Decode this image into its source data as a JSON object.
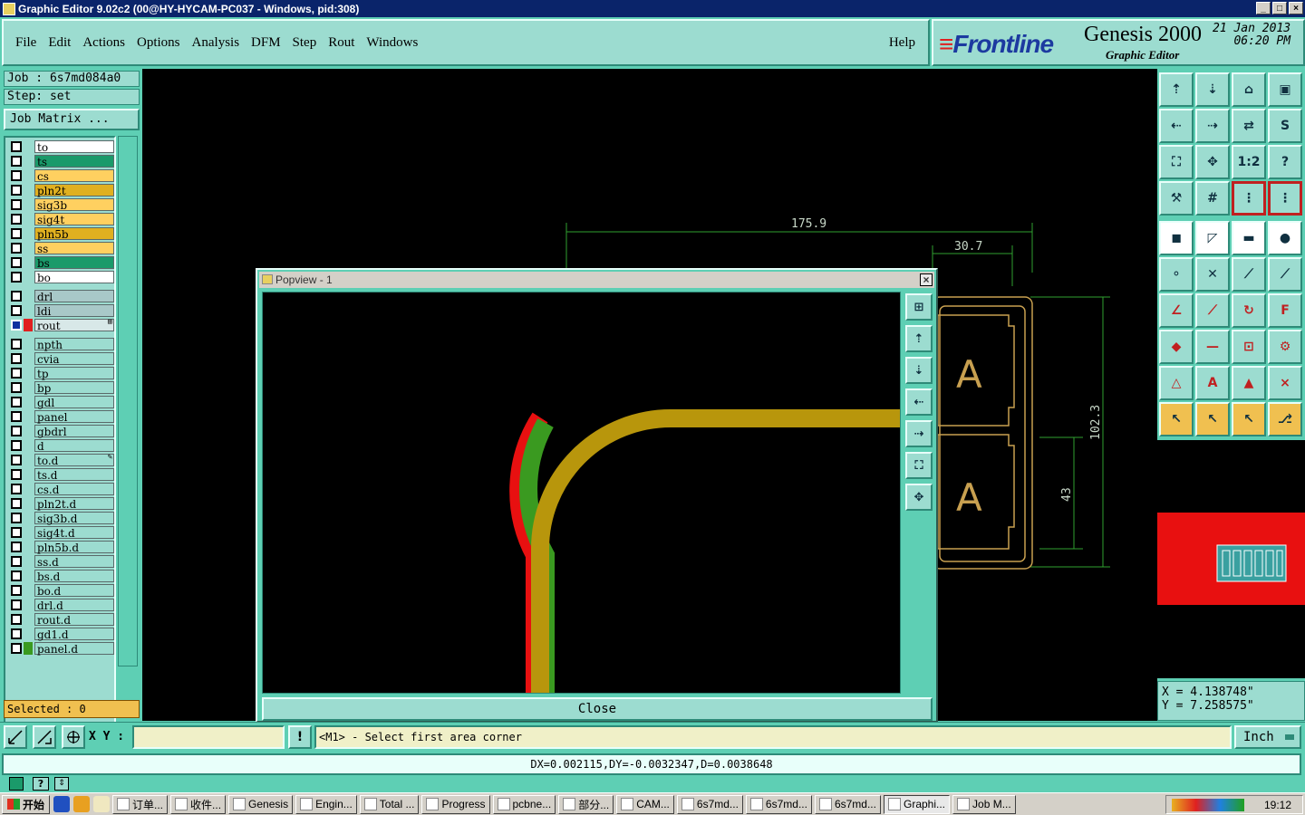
{
  "window": {
    "title": "Graphic Editor 9.02c2 (00@HY-HYCAM-PC037 - Windows, pid:308)",
    "btn_min": "_",
    "btn_max": "□",
    "btn_close": "×"
  },
  "menu": [
    {
      "label": "File"
    },
    {
      "label": "Edit"
    },
    {
      "label": "Actions"
    },
    {
      "label": "Options"
    },
    {
      "label": "Analysis"
    },
    {
      "label": "DFM"
    },
    {
      "label": "Step"
    },
    {
      "label": "Rout"
    },
    {
      "label": "Windows"
    }
  ],
  "menu_help": "Help",
  "brand": {
    "logo": "Frontline",
    "logo_stripes": "≡",
    "product": "Genesis 2000",
    "subtitle": "Graphic Editor",
    "date": "21 Jan 2013",
    "time": "06:20 PM"
  },
  "job": {
    "job_label": "Job  : 6s7md084a0",
    "step_label": "Step: set",
    "job_matrix": "Job Matrix ..."
  },
  "layers": [
    {
      "name": "to",
      "bg": "#ffffff"
    },
    {
      "name": "ts",
      "bg": "#1a9a6a"
    },
    {
      "name": "cs",
      "bg": "#ffd060"
    },
    {
      "name": "pln2t",
      "bg": "#e0b020"
    },
    {
      "name": "sig3b",
      "bg": "#ffd060"
    },
    {
      "name": "sig4t",
      "bg": "#ffd060"
    },
    {
      "name": "pln5b",
      "bg": "#e0b020"
    },
    {
      "name": "ss",
      "bg": "#ffd060"
    },
    {
      "name": "bs",
      "bg": "#1a9a6a"
    },
    {
      "name": "bo",
      "bg": "#ffffff"
    },
    {
      "name": "drl",
      "bg": "#a8c8c8",
      "gap": true
    },
    {
      "name": "ldi",
      "bg": "#a8c8c8"
    },
    {
      "name": "rout",
      "bg": "#d8e8e8",
      "marker": "#e02020",
      "active": true,
      "suffix": "⊞"
    },
    {
      "name": "npth",
      "bg": "#9cdcd0",
      "gap": true
    },
    {
      "name": "cvia",
      "bg": "#9cdcd0"
    },
    {
      "name": "tp",
      "bg": "#9cdcd0"
    },
    {
      "name": "bp",
      "bg": "#9cdcd0"
    },
    {
      "name": "gdl",
      "bg": "#9cdcd0"
    },
    {
      "name": "panel",
      "bg": "#9cdcd0"
    },
    {
      "name": "gbdrl",
      "bg": "#9cdcd0"
    },
    {
      "name": "d",
      "bg": "#9cdcd0"
    },
    {
      "name": "to.d",
      "bg": "#9cdcd0",
      "suffix": "✎"
    },
    {
      "name": "ts.d",
      "bg": "#9cdcd0"
    },
    {
      "name": "cs.d",
      "bg": "#9cdcd0"
    },
    {
      "name": "pln2t.d",
      "bg": "#9cdcd0"
    },
    {
      "name": "sig3b.d",
      "bg": "#9cdcd0"
    },
    {
      "name": "sig4t.d",
      "bg": "#9cdcd0"
    },
    {
      "name": "pln5b.d",
      "bg": "#9cdcd0"
    },
    {
      "name": "ss.d",
      "bg": "#9cdcd0"
    },
    {
      "name": "bs.d",
      "bg": "#9cdcd0"
    },
    {
      "name": "bo.d",
      "bg": "#9cdcd0"
    },
    {
      "name": "drl.d",
      "bg": "#9cdcd0"
    },
    {
      "name": "rout.d",
      "bg": "#9cdcd0"
    },
    {
      "name": "gd1.d",
      "bg": "#9cdcd0"
    },
    {
      "name": "panel.d",
      "bg": "#9cdcd0",
      "marker": "#3a9a20"
    }
  ],
  "selected": "Selected : 0",
  "canvas": {
    "dim1": "175.9",
    "dim2": "30.7",
    "dim3": "102.3",
    "dim4": "43",
    "letter": "A",
    "colors": {
      "outline": "#c8a050",
      "dimension": "#30a030"
    }
  },
  "popview": {
    "title": "Popview - 1",
    "close_label": "Close",
    "colors": {
      "trace": "#b8960c",
      "red": "#e81010",
      "green": "#3a9a20"
    }
  },
  "coords": {
    "x": "X  = 4.138748\"",
    "y": "Y  = 7.258575\""
  },
  "cmd": {
    "xy_label": "X Y :",
    "xy_value": "",
    "warn": "!",
    "prompt": "<M1> - Select first area corner",
    "units": "Inch"
  },
  "status": {
    "text": "DX=0.002115,DY=-0.0032347,D=0.0038648"
  },
  "taskbar": {
    "start": "开始",
    "items": [
      "订单...",
      "收件...",
      "Genesis",
      "Engin...",
      "Total ...",
      "Progress",
      "pcbne...",
      "部分...",
      "CAM...",
      "6s7md...",
      "6s7md...",
      "6s7md...",
      "Graphi...",
      "Job M..."
    ],
    "active_index": 12,
    "clock": "19:12"
  },
  "toolbar_icons": [
    "zoom-page-up-icon",
    "zoom-page-down-icon",
    "home-icon",
    "split-view-icon",
    "pan-left-icon",
    "pan-right-icon",
    "swap-icon",
    "route-s-icon",
    "fit-screen-icon",
    "fit-zoom-icon",
    "scale-1-2-icon",
    "help-icon",
    "measure-tool-icon",
    "grid-icon",
    "layer-pins-icon",
    "layer-pins-alt-icon",
    "pad-icon",
    "polygon-red-icon",
    "ruler-icon",
    "dot-icon",
    "connect-blue-icon",
    "cross-node-icon",
    "line-red-end-icon",
    "line-blue-end-icon",
    "angle-red-icon",
    "slash-red-icon",
    "arc-icon",
    "shape-f-icon",
    "feature-red-icon",
    "line-mid-icon",
    "frame-icon",
    "cluster-icon",
    "triangle-icon",
    "triangle-a-icon",
    "triangle-filled-icon",
    "triangle-cross-icon",
    "pointer-icon",
    "pointer-box-icon",
    "pointer-alt-icon",
    "node-edit-icon"
  ],
  "popview_tools": [
    "page-up-icon",
    "page-top-icon",
    "page-down-icon",
    "pan-left-icon",
    "pan-right-icon",
    "fit-in-icon",
    "fit-out-icon"
  ]
}
